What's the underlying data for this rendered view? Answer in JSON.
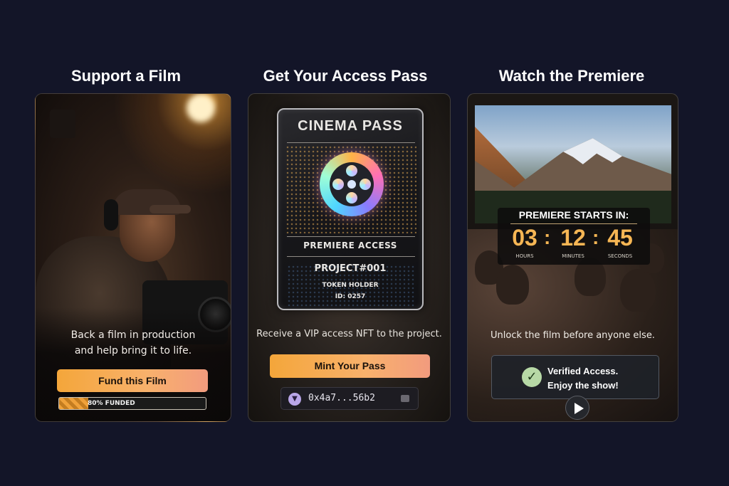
{
  "columns": [
    {
      "title": "Support a Film",
      "description_lines": [
        "Back a film in production",
        "and help bring it to life."
      ],
      "button_label": "Fund this Film",
      "progress": {
        "label": "80% FUNDED",
        "fraction": 0.2
      }
    },
    {
      "title": "Get Your Access Pass",
      "pass": {
        "title": "CINEMA PASS",
        "access": "PREMIERE ACCESS",
        "project": "PROJECT#001",
        "holder": "TOKEN HOLDER",
        "id": "ID: 0257",
        "icon": "film-reel-icon"
      },
      "description": "Receive a VIP access NFT to the project.",
      "button_label": "Mint Your Pass",
      "wallet_address": "0x4a7...56b2",
      "wallet_icon": "wallet-icon",
      "copy_icon": "copy-icon"
    },
    {
      "title": "Watch the Premiere",
      "countdown": {
        "title": "PREMIERE STARTS IN:",
        "hours": "03",
        "minutes": "12",
        "seconds": "45",
        "hours_label": "HOURS",
        "minutes_label": "MINUTES",
        "seconds_label": "SECONDS"
      },
      "description": "Unlock the film before anyone else.",
      "verified_lines": [
        "Verified Access.",
        "Enjoy the show!"
      ],
      "check_icon": "check-circle-icon",
      "play_icon": "play-icon"
    }
  ],
  "colors": {
    "background": "#131528",
    "button_gradient_start": "#f4a63a",
    "button_gradient_end": "#f29b7e",
    "accent_orange": "#f6b654"
  }
}
